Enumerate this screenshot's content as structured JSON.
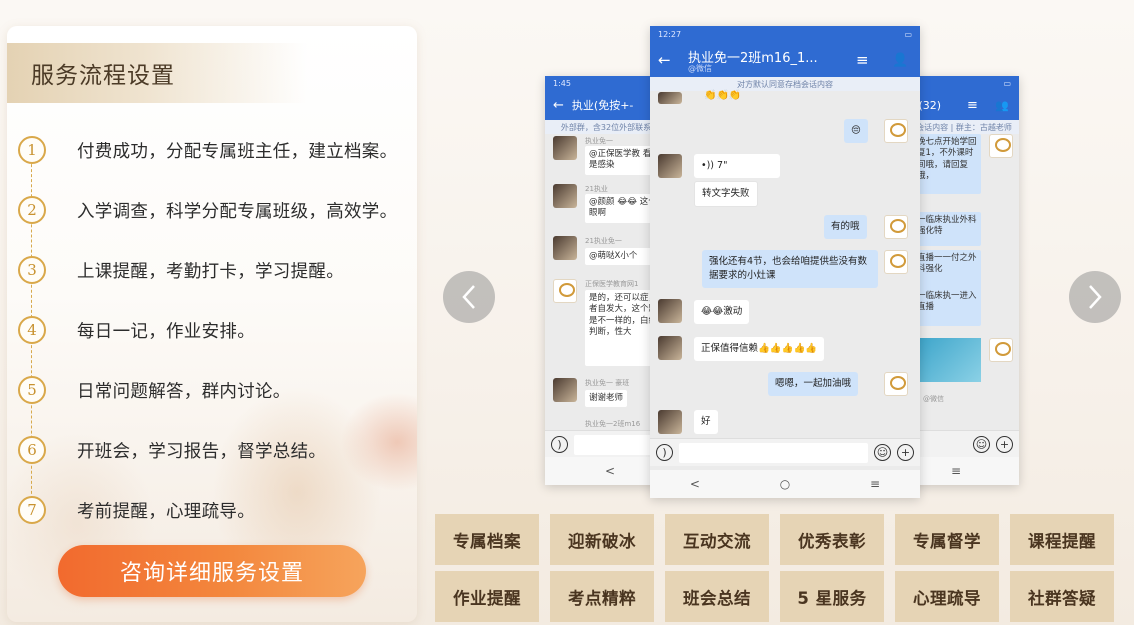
{
  "section": {
    "title": "服务流程设置"
  },
  "steps": [
    {
      "num": "1",
      "text": "付费成功，分配专属班主任，建立档案。"
    },
    {
      "num": "2",
      "text": "入学调查，科学分配专属班级，高效学。"
    },
    {
      "num": "3",
      "text": "上课提醒，考勤打卡，学习提醒。"
    },
    {
      "num": "4",
      "text": "每日一记，作业安排。"
    },
    {
      "num": "5",
      "text": "日常问题解答，群内讨论。"
    },
    {
      "num": "6",
      "text": "开班会，学习报告，督学总结。"
    },
    {
      "num": "7",
      "text": "考前提醒，心理疏导。"
    }
  ],
  "cta": {
    "label": "咨询详细服务设置"
  },
  "colors": {
    "accent": "#f3873d",
    "tag_bg": "#e6d4b5",
    "chat_blue": "#2f6bd2",
    "gold": "#d9a84a"
  },
  "carousel": {
    "prev_icon": "chevron-left-icon",
    "next_icon": "chevron-right-icon",
    "front": {
      "status_time": "12:27",
      "title": "执业免一2班m1",
      "title_suffix": "6_1...",
      "subtitle": "@微信",
      "notice": "对方默认同意存档会话内容",
      "messages": [
        {
          "from": "me",
          "text": "😔"
        },
        {
          "from": "other",
          "text": "•)) 7\""
        },
        {
          "from": "other",
          "text": "转文字失败"
        },
        {
          "from": "me",
          "text": "有的哦"
        },
        {
          "from": "me",
          "text": "强化还有4节，也会给咱提供些没有数据要求的小灶课"
        },
        {
          "from": "other",
          "text": "😂😂激动"
        },
        {
          "from": "other",
          "text": "正保值得信赖👍👍👍👍👍"
        },
        {
          "from": "me",
          "text": "嗯嗯，一起加油哦"
        },
        {
          "from": "other",
          "text": "好"
        }
      ],
      "nav": [
        "<",
        "○",
        "≡"
      ]
    },
    "back_left": {
      "status_time": "1:45",
      "title": "执业(免按+-",
      "notice": "外部群，含32位外部联系人",
      "lines": [
        {
          "name": "执业免一",
          "text": "@正保医学教 看腹水是感染"
        },
        {
          "name": "21执业",
          "text": "@颜颜 😂😂 这个字眼啊"
        },
        {
          "name": "21执业免一",
          "text": "@萌哒X小个"
        },
        {
          "name": "正保医学教育网1",
          "text": "是的，还可以症，患者自发大，这个题目是不一样的，白细胞判断，性大"
        },
        {
          "name": "执业免一 豪班",
          "text": "谢谢老师"
        },
        {
          "name": "执业免一2班m16",
          "text": ""
        }
      ],
      "nav": [
        "<"
      ]
    },
    "back_right": {
      "status_time": "",
      "title": "3...(32)",
      "notice": "存档会话内容 | 群主：古越老师",
      "lines": [
        {
          "text": "晚七点开始学回复1，不外课时间哦，请回复哦，"
        },
        {
          "text": "一临床执业外科强化特"
        },
        {
          "text": "直播一一付之外科强化"
        },
        {
          "text": "一临床执一进入直播"
        }
      ],
      "caption": "@微信",
      "nav": [
        "≡"
      ]
    }
  },
  "tags": [
    [
      "专属档案",
      "迎新破冰",
      "互动交流",
      "优秀表彰",
      "专属督学",
      "课程提醒"
    ],
    [
      "作业提醒",
      "考点精粹",
      "班会总结",
      "5 星服务",
      "心理疏导",
      "社群答疑"
    ]
  ]
}
